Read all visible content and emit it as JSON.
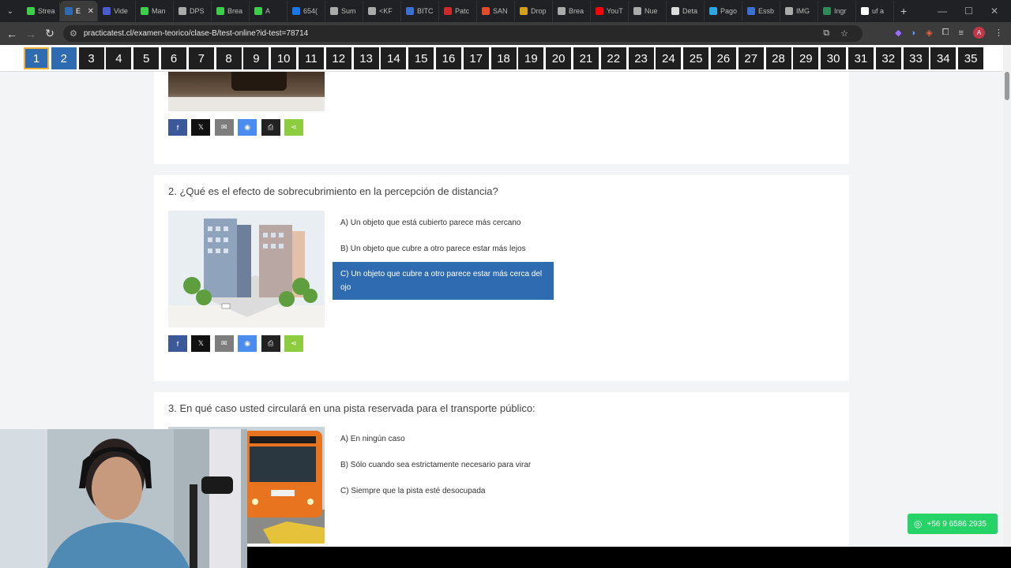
{
  "browser": {
    "tabs": [
      {
        "label": "Strea",
        "color": "#3ecf4a"
      },
      {
        "label": "E",
        "color": "#2f6bb0",
        "active": true
      },
      {
        "label": "Vide",
        "color": "#4a5bd0"
      },
      {
        "label": "Man",
        "color": "#3ecf4a"
      },
      {
        "label": "DPS",
        "color": "#aaaaaa"
      },
      {
        "label": "Brea",
        "color": "#3ecf4a"
      },
      {
        "label": "A",
        "color": "#3ecf4a"
      },
      {
        "label": "654(",
        "color": "#1877f2"
      },
      {
        "label": "Sum",
        "color": "#aaaaaa"
      },
      {
        "label": "<KF",
        "color": "#aaaaaa"
      },
      {
        "label": "BITC",
        "color": "#3b6fd1"
      },
      {
        "label": "Patc",
        "color": "#cc2a2a"
      },
      {
        "label": "SAN",
        "color": "#e34b2a"
      },
      {
        "label": "Drop",
        "color": "#d4a017"
      },
      {
        "label": "Brea",
        "color": "#aaaaaa"
      },
      {
        "label": "YouT",
        "color": "#ff0000"
      },
      {
        "label": "Nue",
        "color": "#aaaaaa"
      },
      {
        "label": "Deta",
        "color": "#dddddd"
      },
      {
        "label": "Pago",
        "color": "#2aa8e0"
      },
      {
        "label": "Essb",
        "color": "#3b6fd1"
      },
      {
        "label": "IMG",
        "color": "#aaaaaa"
      },
      {
        "label": "Ingr",
        "color": "#2e8b57"
      },
      {
        "label": "uf a",
        "color": "#ffffff"
      }
    ],
    "tab_close": "✕",
    "new_tab": "+",
    "url": "practicatest.cl/examen-teorico/clase-B/test-online?id-test=78714",
    "profile_initial": "A"
  },
  "question_nav": {
    "numbers": [
      "1",
      "2",
      "3",
      "4",
      "5",
      "6",
      "7",
      "8",
      "9",
      "10",
      "11",
      "12",
      "13",
      "14",
      "15",
      "16",
      "17",
      "18",
      "19",
      "20",
      "21",
      "22",
      "23",
      "24",
      "25",
      "26",
      "27",
      "28",
      "29",
      "30",
      "31",
      "32",
      "33",
      "34",
      "35"
    ],
    "current": 0,
    "answered": [
      1
    ]
  },
  "questions": [
    {
      "text": "2. ¿Qué es el efecto de sobrecubrimiento en la percepción de distancia?",
      "options": [
        "A) Un objeto que está cubierto parece más cercano",
        "B) Un objeto que cubre a otro parece estar más lejos",
        "C) Un objeto que cubre a otro parece estar más cerca del ojo"
      ],
      "selected_index": 2
    },
    {
      "text": "3. En qué caso usted circulará en una pista reservada para el transporte público:",
      "options": [
        "A) En ningún caso",
        "B) Sólo cuando sea estrictamente necesario para virar",
        "C) Siempre que la pista esté desocupada"
      ]
    }
  ],
  "share_buttons": [
    {
      "name": "facebook",
      "glyph": "f",
      "color": "#3b5998"
    },
    {
      "name": "twitter",
      "glyph": "𝕏",
      "color": "#111111"
    },
    {
      "name": "email",
      "glyph": "✉",
      "color": "#7d7d7d"
    },
    {
      "name": "messenger",
      "glyph": "◉",
      "color": "#4a8cf0"
    },
    {
      "name": "print",
      "glyph": "⎙",
      "color": "#222222"
    },
    {
      "name": "sharethis",
      "glyph": "⋖",
      "color": "#8dcc3e"
    }
  ],
  "whatsapp": {
    "label": "+56 9 6586 2935",
    "color": "#25d366"
  }
}
